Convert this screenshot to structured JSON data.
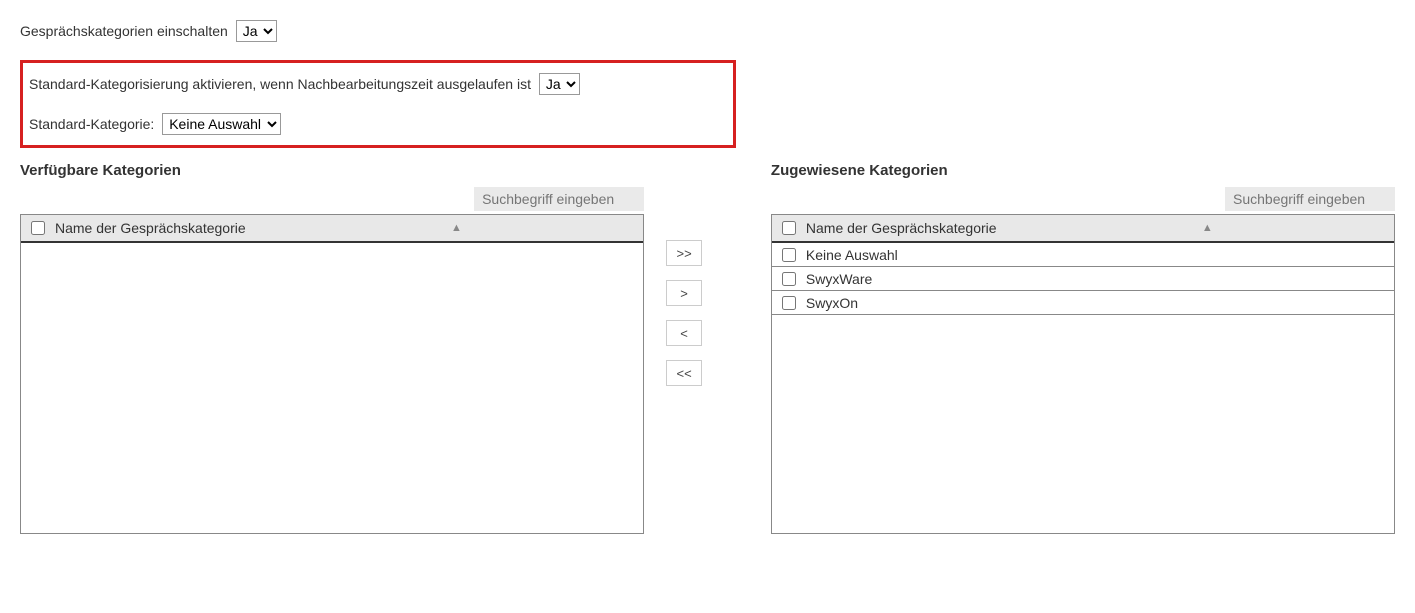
{
  "toggle": {
    "label": "Gesprächskategorien einschalten",
    "value": "Ja"
  },
  "highlight": {
    "autoCatLabel": "Standard-Kategorisierung aktivieren, wenn Nachbearbeitungszeit ausgelaufen ist",
    "autoCatValue": "Ja",
    "stdCatLabel": "Standard-Kategorie:",
    "stdCatValue": "Keine Auswahl"
  },
  "available": {
    "title": "Verfügbare Kategorien",
    "searchPlaceholder": "Suchbegriff eingeben",
    "columnHeader": "Name der Gesprächskategorie",
    "rows": []
  },
  "assigned": {
    "title": "Zugewiesene Kategorien",
    "searchPlaceholder": "Suchbegriff eingeben",
    "columnHeader": "Name der Gesprächskategorie",
    "rows": [
      "Keine Auswahl",
      "SwyxWare",
      "SwyxOn"
    ]
  },
  "transfer": {
    "allRight": ">>",
    "right": ">",
    "left": "<",
    "allLeft": "<<"
  }
}
